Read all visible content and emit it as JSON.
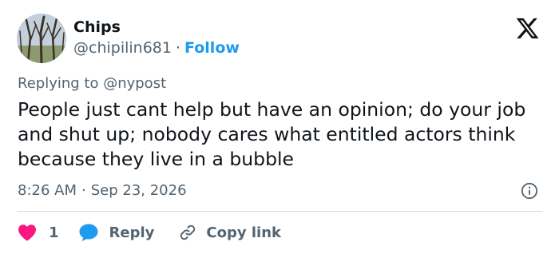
{
  "author": {
    "name": "Chips",
    "handle": "@chipilin681",
    "separator": "·",
    "follow_label": "Follow"
  },
  "reply_context": {
    "text": "Replying to @nypost"
  },
  "tweet": {
    "text": "People just cant help but have an opinion; do your job and shut up; nobody cares what entitled actors think because they live in a bubble",
    "time": "8:26 AM",
    "separator": "·",
    "date": "Sep 23, 2026"
  },
  "actions": {
    "like_count": "1",
    "reply_label": "Reply",
    "copy_link_label": "Copy link"
  },
  "icons": {
    "logo": "x-logo-icon",
    "info": "info-icon",
    "like": "heart-icon",
    "reply": "chat-bubble-icon",
    "copy": "link-icon"
  },
  "colors": {
    "accent": "#1d9bf0",
    "like": "#f91880",
    "text_primary": "#0f1419",
    "text_secondary": "#536471",
    "divider": "#cfd9de"
  }
}
